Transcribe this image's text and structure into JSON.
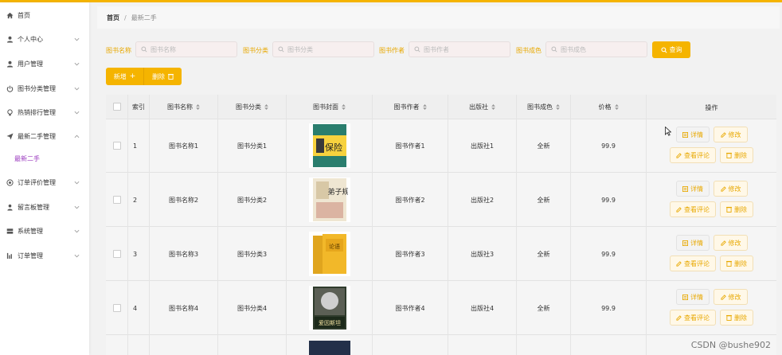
{
  "sidebar": {
    "items": [
      {
        "label": "首页",
        "icon": "home-icon",
        "has_chevron": false
      },
      {
        "label": "个人中心",
        "icon": "user-icon",
        "has_chevron": true
      },
      {
        "label": "用户管理",
        "icon": "users-icon",
        "has_chevron": true
      },
      {
        "label": "图书分类管理",
        "icon": "power-icon",
        "has_chevron": true
      },
      {
        "label": "热销排行管理",
        "icon": "bulb-icon",
        "has_chevron": true
      },
      {
        "label": "最新二手管理",
        "icon": "send-icon",
        "has_chevron": true,
        "expanded": true
      },
      {
        "label": "订单评价管理",
        "icon": "target-icon",
        "has_chevron": true
      },
      {
        "label": "留言板管理",
        "icon": "person-pin-icon",
        "has_chevron": true
      },
      {
        "label": "系统管理",
        "icon": "server-icon",
        "has_chevron": true
      },
      {
        "label": "订单管理",
        "icon": "chart-icon",
        "has_chevron": true
      }
    ],
    "sub_item": "最新二手",
    "sub_item_color": "#9b3bbf"
  },
  "breadcrumb": {
    "home": "首页",
    "separator": "/",
    "current": "最新二手"
  },
  "search": {
    "fields": [
      {
        "label": "图书名称",
        "placeholder": "图书名称"
      },
      {
        "label": "图书分类",
        "placeholder": "图书分类"
      },
      {
        "label": "图书作者",
        "placeholder": "图书作者"
      },
      {
        "label": "图书成色",
        "placeholder": "图书成色"
      }
    ],
    "query_label": "查询",
    "label_color": "#e8a800"
  },
  "actions": {
    "add_label": "新增",
    "delete_label": "删除"
  },
  "colors": {
    "accent": "#f5b400",
    "action_text": "#e8a800"
  },
  "table": {
    "columns": [
      "索引",
      "图书名称",
      "图书分类",
      "图书封面",
      "图书作者",
      "出版社",
      "图书成色",
      "价格",
      "操作"
    ],
    "rows": [
      {
        "index": "1",
        "name": "图书名称1",
        "category": "图书分类1",
        "author": "图书作者1",
        "publisher": "出版社1",
        "condition": "全新",
        "price": "99.9",
        "cover_title": "保险"
      },
      {
        "index": "2",
        "name": "图书名称2",
        "category": "图书分类2",
        "author": "图书作者2",
        "publisher": "出版社2",
        "condition": "全新",
        "price": "99.9",
        "cover_title": "弟子规"
      },
      {
        "index": "3",
        "name": "图书名称3",
        "category": "图书分类3",
        "author": "图书作者3",
        "publisher": "出版社3",
        "condition": "全新",
        "price": "99.9",
        "cover_title": "论语"
      },
      {
        "index": "4",
        "name": "图书名称4",
        "category": "图书分类4",
        "author": "图书作者4",
        "publisher": "出版社4",
        "condition": "全新",
        "price": "99.9",
        "cover_title": "爱因斯坦"
      }
    ],
    "row_actions": {
      "detail": "详情",
      "edit": "修改",
      "review": "查看评论",
      "delete": "删除"
    }
  },
  "watermark": "CSDN @bushe902"
}
